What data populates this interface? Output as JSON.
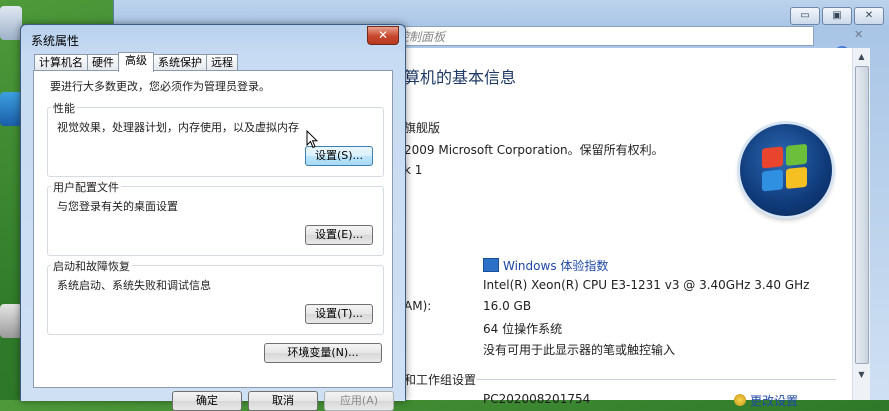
{
  "background_window": {
    "address_text": "控制面板",
    "caption_buttons": {
      "minimize": "▭",
      "maximize": "▣",
      "close": "✕"
    },
    "heading": "算机的基本信息",
    "edition_line": "旗舰版",
    "copyright_line": "2009 Microsoft Corporation。保留所有权利。",
    "service_pack_fragment": "k 1",
    "wei_link": "Windows 体验指数",
    "processor": "Intel(R) Xeon(R) CPU E3-1231 v3 @ 3.40GHz   3.40 GHz",
    "ram_label_fragment": "AM):",
    "ram": "16.0 GB",
    "system_type": "64 位操作系统",
    "pen_touch": "没有可用于此显示器的笔或触控输入",
    "computer_section": "和工作组设置",
    "computer_name_fragment": "PC202008201754",
    "change_settings_fragment": "更改设置"
  },
  "dialog": {
    "title": "系统属性",
    "close_glyph": "✕",
    "tabs": [
      {
        "label": "计算机名",
        "active": false
      },
      {
        "label": "硬件",
        "active": false
      },
      {
        "label": "高级",
        "active": true
      },
      {
        "label": "系统保护",
        "active": false
      },
      {
        "label": "远程",
        "active": false
      }
    ],
    "notice": "要进行大多数更改，您必须作为管理员登录。",
    "performance": {
      "label": "性能",
      "description": "视觉效果，处理器计划，内存使用，以及虚拟内存",
      "button": "设置(S)..."
    },
    "user_profiles": {
      "label": "用户配置文件",
      "description": "与您登录有关的桌面设置",
      "button": "设置(E)..."
    },
    "startup_recovery": {
      "label": "启动和故障恢复",
      "description": "系统启动、系统失败和调试信息",
      "button": "设置(T)..."
    },
    "env_vars_button": "环境变量(N)...",
    "ok_button": "确定",
    "cancel_button": "取消",
    "apply_button": "应用(A)"
  }
}
